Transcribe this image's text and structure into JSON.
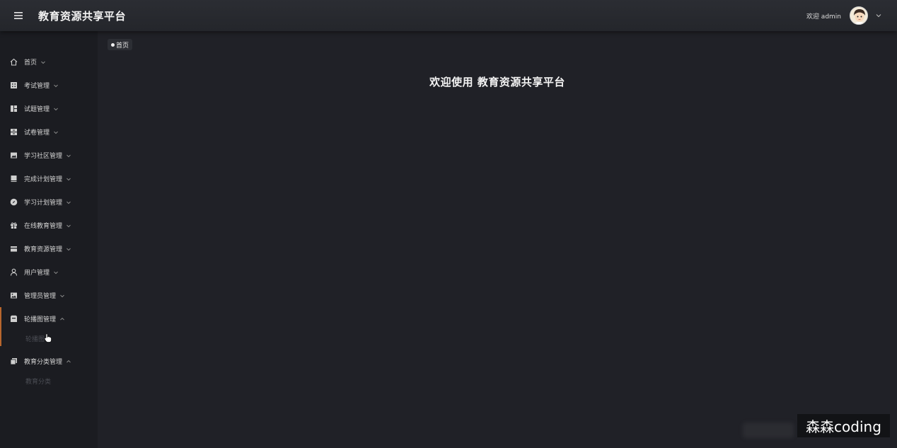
{
  "header": {
    "title": "教育资源共享平台",
    "welcome_text": "欢迎 admin",
    "menu_icon": "hamburger-icon",
    "user_menu_icon": "chevron-down-icon"
  },
  "sidebar": {
    "items": [
      {
        "label": "首页",
        "icon": "home-icon",
        "expanded": false
      },
      {
        "label": "考试管理",
        "icon": "exam-icon",
        "expanded": false
      },
      {
        "label": "试题管理",
        "icon": "dashboard-icon",
        "expanded": false
      },
      {
        "label": "试卷管理",
        "icon": "paper-icon",
        "expanded": false
      },
      {
        "label": "学习社区管理",
        "icon": "image-icon",
        "expanded": false
      },
      {
        "label": "完成计划管理",
        "icon": "book-icon",
        "expanded": false
      },
      {
        "label": "学习计划管理",
        "icon": "compass-icon",
        "expanded": false
      },
      {
        "label": "在线教育管理",
        "icon": "gift-icon",
        "expanded": false
      },
      {
        "label": "教育资源管理",
        "icon": "card-icon",
        "expanded": false
      },
      {
        "label": "用户管理",
        "icon": "user-icon",
        "expanded": false
      },
      {
        "label": "管理员管理",
        "icon": "picture-icon",
        "expanded": false
      },
      {
        "label": "轮播图管理",
        "icon": "inbox-icon",
        "expanded": true,
        "children": [
          "轮播图"
        ]
      },
      {
        "label": "教育分类管理",
        "icon": "copy-icon",
        "expanded": true,
        "children": [
          "教育分类"
        ]
      }
    ]
  },
  "main": {
    "breadcrumb": "首页",
    "welcome_title": "欢迎使用 教育资源共享平台"
  },
  "watermark": "森森coding",
  "colors": {
    "header_bg": "#2b2d33",
    "sidebar_bg": "#1b1c21",
    "main_bg": "#202127",
    "active_accent": "#b8662d"
  }
}
